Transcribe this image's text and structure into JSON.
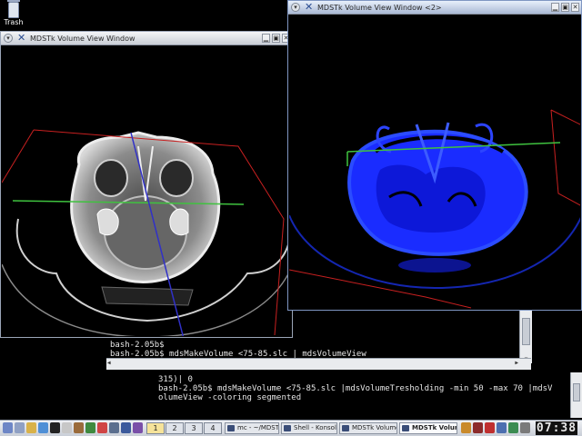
{
  "desktop": {
    "trash_label": "Trash"
  },
  "windows": {
    "left": {
      "title": "MDSTk Volume View Window",
      "viewport_mode": "grayscale"
    },
    "right": {
      "title": "MDSTk Volume View Window <2>",
      "viewport_mode": "segmented"
    }
  },
  "title_buttons": {
    "menu": "▾",
    "minimize": "▁",
    "maximize": "▣",
    "close": "✕"
  },
  "terminal_top": {
    "lines": [
      "bash-2.05b$",
      "bash-2.05b$ mdsMakeVolume <75-85.slc | mdsVolumeView"
    ]
  },
  "terminal_bottom": {
    "lines": [
      "315)| 0",
      "bash-2.05b$ mdsMakeVolume <75-85.slc |mdsVolumeTresholding -min 50 -max 70 |mdsV",
      "olumeView -coloring segmented"
    ]
  },
  "taskbar": {
    "pager": [
      "1",
      "2",
      "3",
      "4"
    ],
    "active_desktop": "1",
    "tasks": [
      {
        "label": "mc - ~/MDSTk",
        "active": false
      },
      {
        "label": "Shell - Konsole",
        "active": false
      },
      {
        "label": "MDSTk Volume",
        "active": false
      },
      {
        "label": "MDSTk Volume",
        "active": true
      }
    ],
    "clock": "07:38"
  },
  "colors": {
    "accent_blue": "#1a2cff",
    "box_red": "#c82020",
    "plane_green": "#3fc23f",
    "axis_blue": "#3030c8"
  }
}
